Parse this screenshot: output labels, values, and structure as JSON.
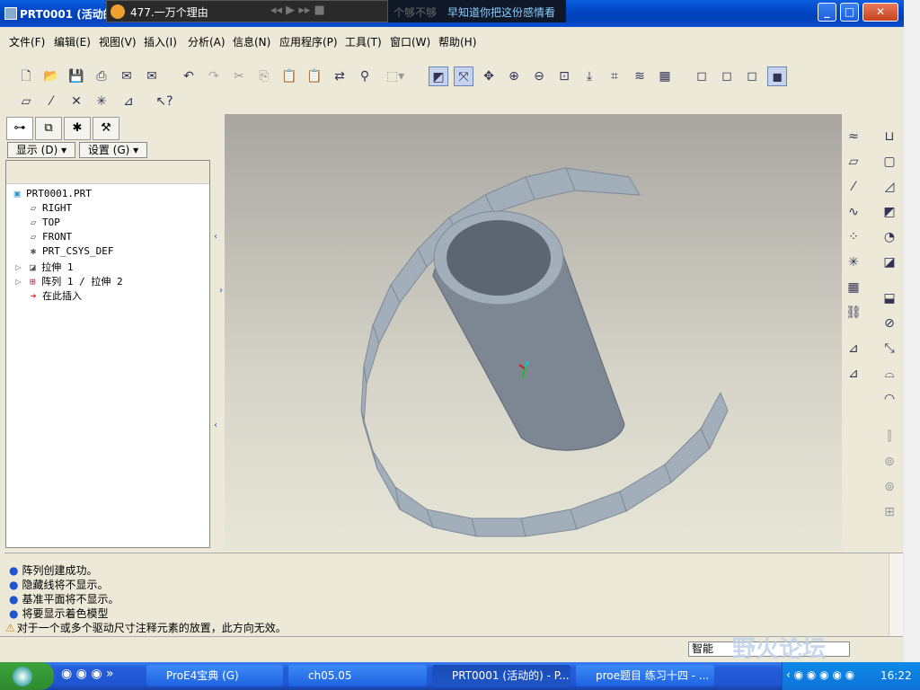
{
  "window": {
    "title": "PRT0001 (活动的",
    "min": "_",
    "max": "□",
    "close": "✕"
  },
  "player": {
    "title": "477.一万个理由"
  },
  "lyrics": {
    "prev": "个够不够",
    "current": "早知道你把这份感情看"
  },
  "menu": [
    "文件(F)",
    "编辑(E)",
    "视图(V)",
    "插入(I)",
    "分析(A)",
    "信息(N)",
    "应用程序(P)",
    "工具(T)",
    "窗口(W)",
    "帮助(H)"
  ],
  "panel": {
    "show_label": "显示 (D) ▾",
    "settings_label": "设置 (G) ▾"
  },
  "tree": [
    {
      "icon": "part-icon",
      "glyph": "▣",
      "label": "PRT0001.PRT"
    },
    {
      "icon": "datum-plane-icon",
      "glyph": "▱",
      "label": "RIGHT"
    },
    {
      "icon": "datum-plane-icon",
      "glyph": "▱",
      "label": "TOP"
    },
    {
      "icon": "datum-plane-icon",
      "glyph": "▱",
      "label": "FRONT"
    },
    {
      "icon": "csys-icon",
      "glyph": "✱",
      "label": "PRT_CSYS_DEF"
    },
    {
      "icon": "extrude-icon",
      "glyph": "◪",
      "label": "拉伸 1"
    },
    {
      "icon": "pattern-icon",
      "glyph": "⊞",
      "label": "阵列 1 / 拉伸 2"
    },
    {
      "icon": "insert-here-icon",
      "glyph": "➜",
      "label": "在此插入"
    }
  ],
  "messages": [
    {
      "type": "info",
      "text": "阵列创建成功。"
    },
    {
      "type": "info",
      "text": "隐藏线将不显示。"
    },
    {
      "type": "info",
      "text": "基准平面将不显示。"
    },
    {
      "type": "info",
      "text": "将要显示着色模型"
    },
    {
      "type": "warning",
      "text": "对于一个或多个驱动尺寸注释元素的放置，此方向无效。"
    }
  ],
  "status": {
    "filter": "智能"
  },
  "taskbar": {
    "tasks": [
      "ProE4宝典 (G)",
      "ch05.05",
      "PRT0001 (活动的) - P...",
      "proe题目 练习十四 - ..."
    ],
    "clock": "16:22"
  },
  "watermark": "野火论坛",
  "colors": {
    "model": "#a3aebb",
    "titlebar": "#0346c4",
    "message_bullet": "#2255cc"
  }
}
